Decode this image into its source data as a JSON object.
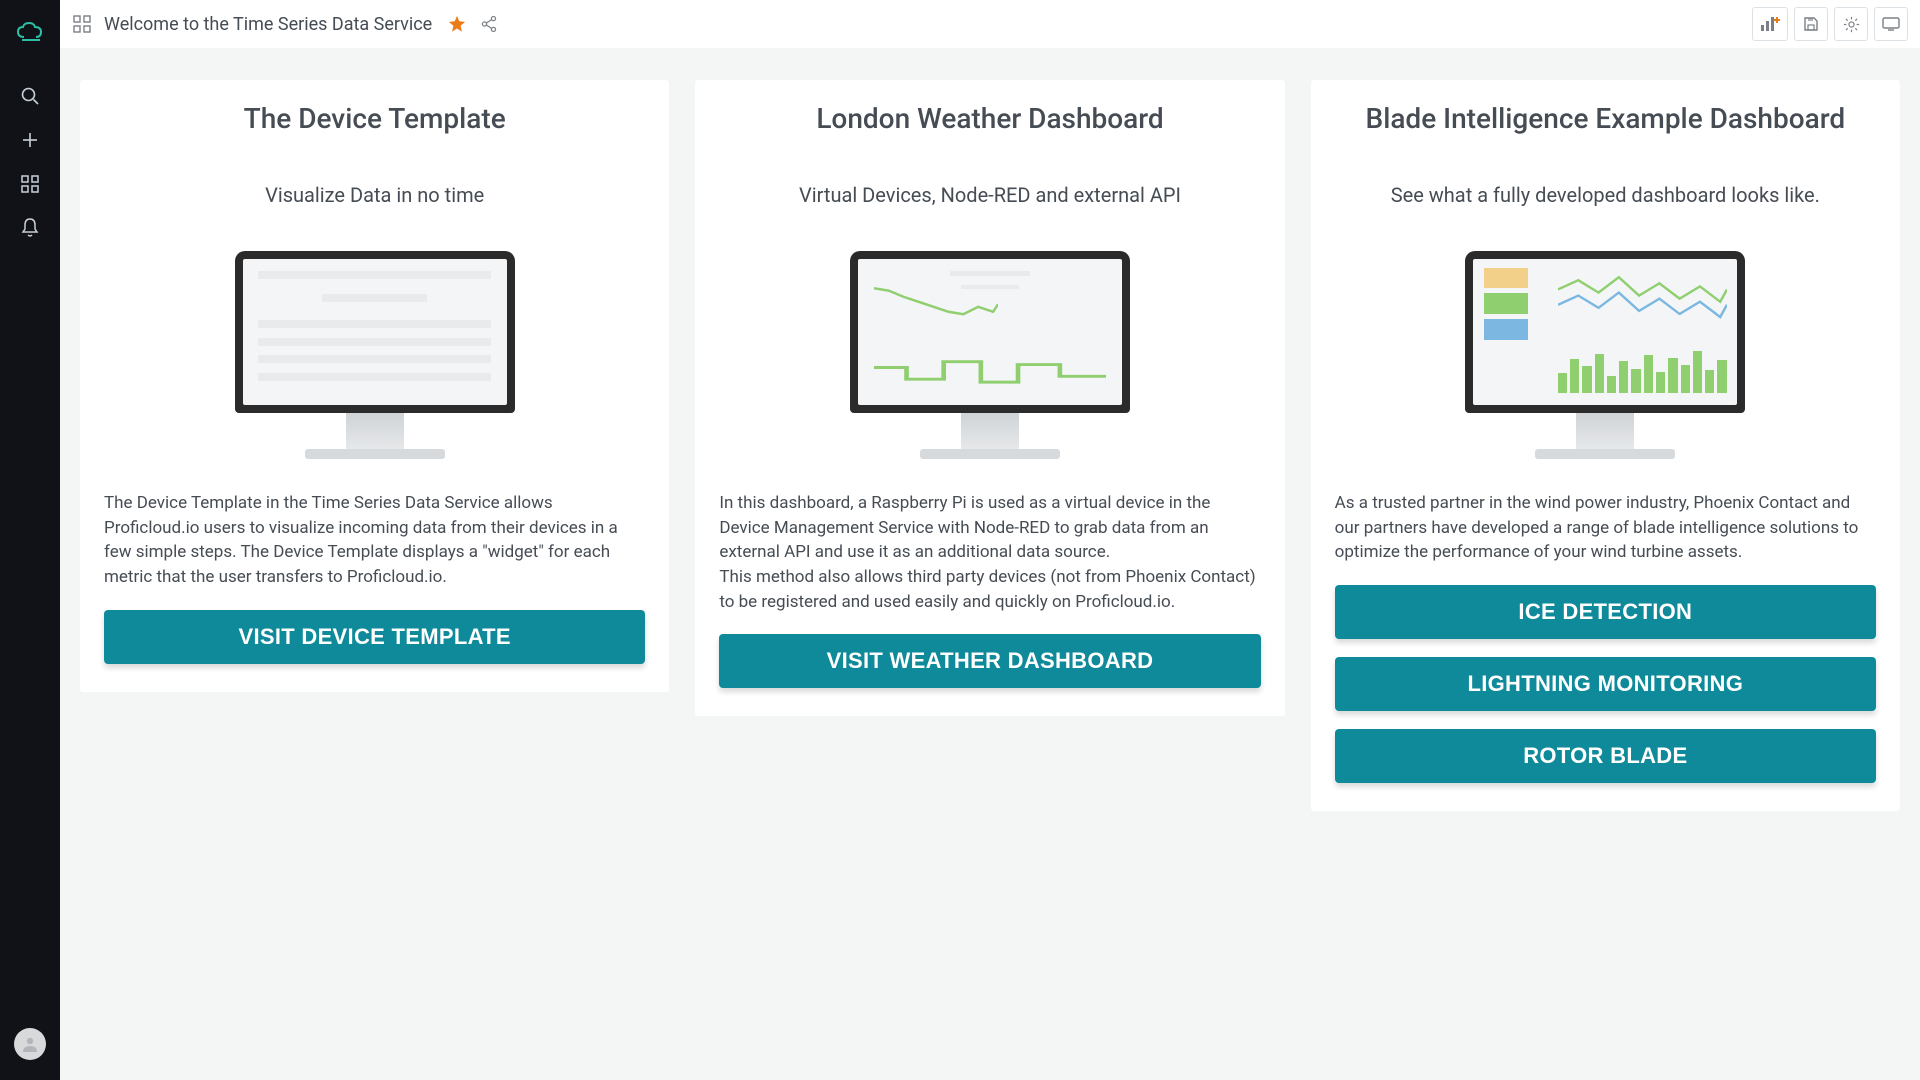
{
  "header": {
    "title": "Welcome to the Time Series Data Service"
  },
  "colors": {
    "accent": "#0e8a9a",
    "star": "#eb7b18"
  },
  "panels": [
    {
      "title": "The Device Template",
      "subtitle": "Visualize Data in no time",
      "description": "The Device Template in the Time Series Data Service allows Proficloud.io users to visualize incoming data from their devices in a few simple steps. The Device Template displays a \"widget\" for each metric that the user transfers to Proficloud.io.",
      "buttons": [
        "VISIT DEVICE TEMPLATE"
      ]
    },
    {
      "title": "London Weather Dashboard",
      "subtitle": "Virtual Devices, Node-RED and external API",
      "description": "In this dashboard, a Raspberry Pi is used as a virtual device in the Device Management Service with Node-RED to grab data from an external API and use it as an additional data source.\nThis method also allows third party devices (not from Phoenix Contact) to be registered and used easily and quickly on Proficloud.io.",
      "buttons": [
        "VISIT WEATHER DASHBOARD"
      ]
    },
    {
      "title": "Blade Intelligence Example Dashboard",
      "subtitle": "See what a fully developed dashboard looks like.",
      "description": "As a trusted partner in the wind power industry, Phoenix Contact and our partners have developed a range of blade intelligence solutions to optimize the performance of your wind turbine assets.",
      "buttons": [
        "ICE DETECTION",
        "LIGHTNING MONITORING",
        "ROTOR BLADE"
      ]
    }
  ]
}
